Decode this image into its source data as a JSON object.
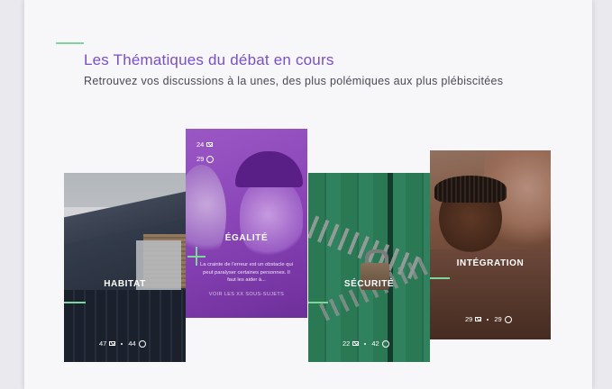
{
  "header": {
    "title": "Les Thématiques du débat en cours",
    "subtitle": "Retrouvez vos discussions à la unes, des plus polémiques aux plus plébiscitées"
  },
  "colors": {
    "accent_purple": "#7a4fc4",
    "accent_green": "#7ed69a",
    "background": "#f7f7fa"
  },
  "cards": [
    {
      "id": "habitat",
      "label": "HABITAT",
      "messages": "47",
      "users": "44"
    },
    {
      "id": "egalite",
      "label": "ÉGALITÉ",
      "messages": "24",
      "users": "29",
      "excerpt": "La crainte de l'erreur est un obstacle qui peut paralyser certaines personnes. Il faut les aider à...",
      "link": "VOIR LES XX SOUS-SUJETS"
    },
    {
      "id": "securite",
      "label": "SÉCURITÉ",
      "messages": "22",
      "users": "42"
    },
    {
      "id": "integration",
      "label": "INTÉGRATION",
      "messages": "29",
      "users": "29"
    }
  ]
}
